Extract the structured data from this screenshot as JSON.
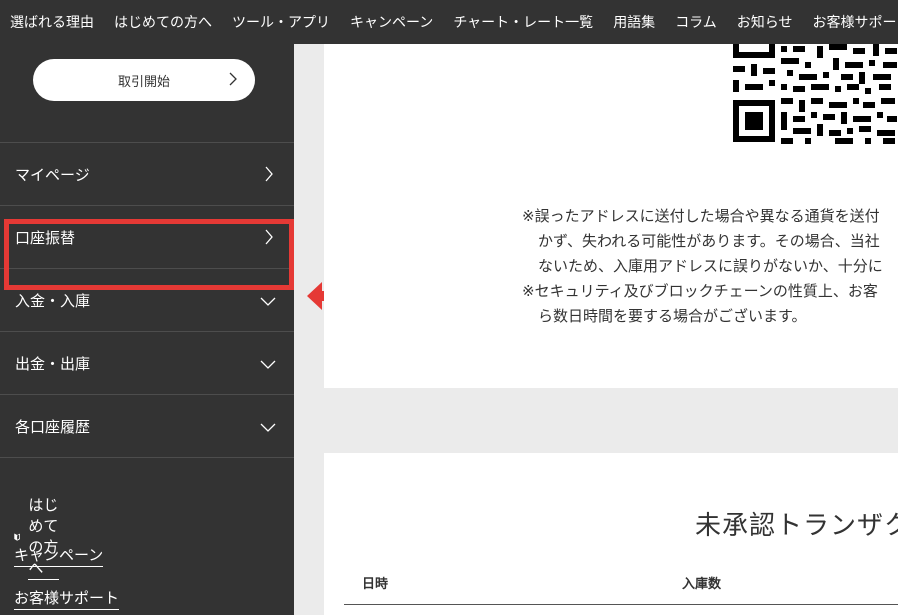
{
  "top_nav": [
    "選ばれる理由",
    "はじめての方へ",
    "ツール・アプリ",
    "キャンペーン",
    "チャート・レート一覧",
    "用語集",
    "コラム",
    "お知らせ",
    "お客様サポート"
  ],
  "sidebar": {
    "trade_button": "取引開始",
    "menu": [
      {
        "label": "マイページ",
        "icon": "chevron-right-icon"
      },
      {
        "label": "口座振替",
        "icon": "chevron-right-icon"
      },
      {
        "label": "入金・入庫",
        "icon": "chevron-down-icon"
      },
      {
        "label": "出金・出庫",
        "icon": "chevron-down-icon"
      },
      {
        "label": "各口座履歴",
        "icon": "chevron-down-icon"
      }
    ],
    "links": {
      "beginner": "はじめての方へ",
      "campaign": "キャンペーン",
      "support": "お客様サポート"
    }
  },
  "annotation": {
    "highlight_color": "#e53935"
  },
  "main": {
    "notes": [
      "※誤ったアドレスに送付した場合や異なる通貨を送付",
      "かず、失われる可能性があります。その場合、当社",
      "ないため、入庫用アドレスに誤りがないか、十分に",
      "※セキュリティ及びブロックチェーンの性質上、お客",
      "ら数日時間を要する場合がございます。"
    ],
    "pending_title": "未承認トランザク",
    "table_headers": {
      "date": "日時",
      "amount": "入庫数"
    }
  }
}
